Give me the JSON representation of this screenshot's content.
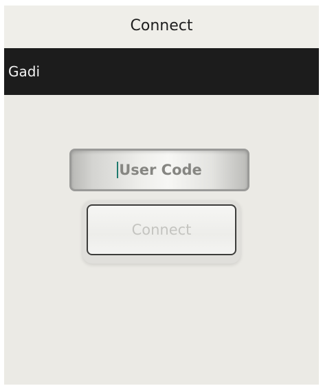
{
  "window": {
    "title": "Connect"
  },
  "action_bar": {
    "title": "Gadi"
  },
  "form": {
    "user_code": {
      "value": "",
      "placeholder": "User Code"
    },
    "connect_label": "Connect"
  },
  "colors": {
    "action_bar_bg": "#1c1c1c",
    "content_bg": "#ebeae5",
    "caret": "#1f7a6e"
  }
}
